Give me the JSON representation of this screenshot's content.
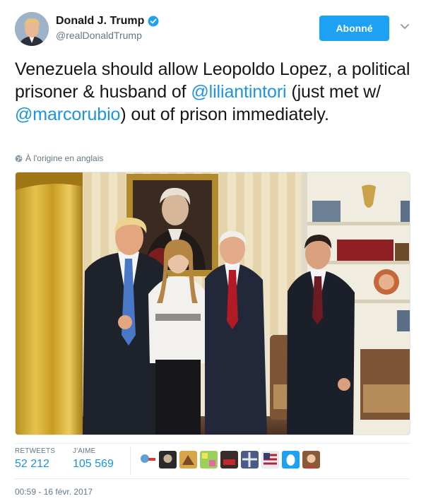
{
  "header": {
    "display_name": "Donald J. Trump",
    "handle": "@realDonaldTrump",
    "follow_label": "Abonné",
    "verified_icon": "verified-badge-icon",
    "accent_color": "#1da1f2"
  },
  "tweet": {
    "part1": "Venezuela should allow Leopoldo Lopez, a political prisoner & husband of ",
    "mention1": "@liliantintori",
    "part2": " (just met w/ ",
    "mention2": "@marcorubio",
    "part3": ") out of prison immediately.",
    "mention_color": "#1b95e0"
  },
  "translate": {
    "icon": "globe-icon",
    "label": "À l'origine en anglais"
  },
  "stats": {
    "retweets_label": "RETWEETS",
    "retweets_value": "52 212",
    "likes_label": "J'AIME",
    "likes_value": "105 569"
  },
  "timestamp": "00:59 - 16 févr. 2017"
}
